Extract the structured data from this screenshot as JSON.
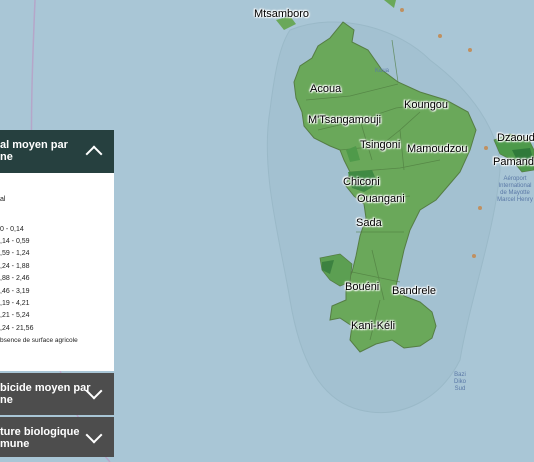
{
  "map": {
    "places": [
      {
        "id": "mtsamboro",
        "label": "Mtsamboro"
      },
      {
        "id": "acoua",
        "label": "Acoua"
      },
      {
        "id": "koungou",
        "label": "Koungou"
      },
      {
        "id": "mtsangamouji",
        "label": "M'Tsangamouji"
      },
      {
        "id": "tsingoni",
        "label": "Tsingoni"
      },
      {
        "id": "mamoudzou",
        "label": "Mamoudzou"
      },
      {
        "id": "dzaoudzi",
        "label": "Dzaoud"
      },
      {
        "id": "pamandzi",
        "label": "Pamand"
      },
      {
        "id": "chiconi",
        "label": "Chiconi"
      },
      {
        "id": "ouangani",
        "label": "Ouangani"
      },
      {
        "id": "sada",
        "label": "Sada"
      },
      {
        "id": "boueni",
        "label": "Bouéni"
      },
      {
        "id": "bandrele",
        "label": "Bandrele"
      },
      {
        "id": "kanikeli",
        "label": "Kani-Kéli"
      }
    ],
    "minor_labels": {
      "koua": "Koua",
      "airport": "Aéroport International de Mayotte Marcel Henry",
      "bazi": "Bazi Diko Sud"
    },
    "colors": {
      "sea": "#a9c6d6",
      "land": "#6aa85a",
      "land_dark": "#3f8a43",
      "reef": "#8fb8c4"
    }
  },
  "legend": {
    "panel1": {
      "title_line1": "al moyen par",
      "title_line2": "ne",
      "expanded": true
    },
    "subtitle": "al",
    "classes": [
      {
        "range": "0 - 0,14"
      },
      {
        "range": ",14 - 0,59"
      },
      {
        "range": ",59 - 1,24"
      },
      {
        "range": ",24 - 1,88"
      },
      {
        "range": ",88 - 2,46"
      },
      {
        "range": ",46 - 3,19"
      },
      {
        "range": ",19 - 4,21"
      },
      {
        "range": ",21 - 5,24"
      },
      {
        "range": ",24 - 21,56"
      }
    ],
    "absence": "bsence de surface agricole",
    "panel2": {
      "title_line1": "bicide moyen par",
      "title_line2": "ne",
      "expanded": false
    },
    "panel3": {
      "title_line1": "ture biologique",
      "title_line2": "mune",
      "expanded": false
    }
  }
}
